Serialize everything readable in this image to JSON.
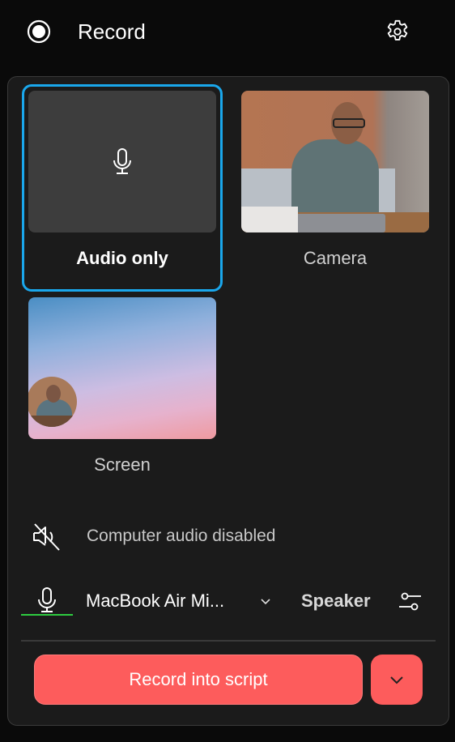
{
  "header": {
    "title": "Record",
    "record_icon": "record-circle-icon",
    "settings_icon": "gear-icon"
  },
  "sources": [
    {
      "label": "Audio only",
      "icon": "microphone-icon",
      "selected": true
    },
    {
      "label": "Camera",
      "thumbnail": "camera-preview-man-at-desk",
      "selected": false
    },
    {
      "label": "Screen",
      "thumbnail": "gradient-screen-with-camera-bubble",
      "selected": false
    }
  ],
  "computer_audio": {
    "icon": "speaker-muted-icon",
    "label": "Computer audio disabled"
  },
  "microphone": {
    "icon": "microphone-icon",
    "selected_device": "MacBook Air Mi...",
    "level_color": "#2ecc40",
    "dropdown_icon": "chevron-down-icon"
  },
  "speaker": {
    "label": "Speaker",
    "settings_icon": "sliders-icon"
  },
  "footer": {
    "record_button_label": "Record into script",
    "record_options_icon": "chevron-down-icon",
    "accent_color": "#fd5c5c"
  }
}
